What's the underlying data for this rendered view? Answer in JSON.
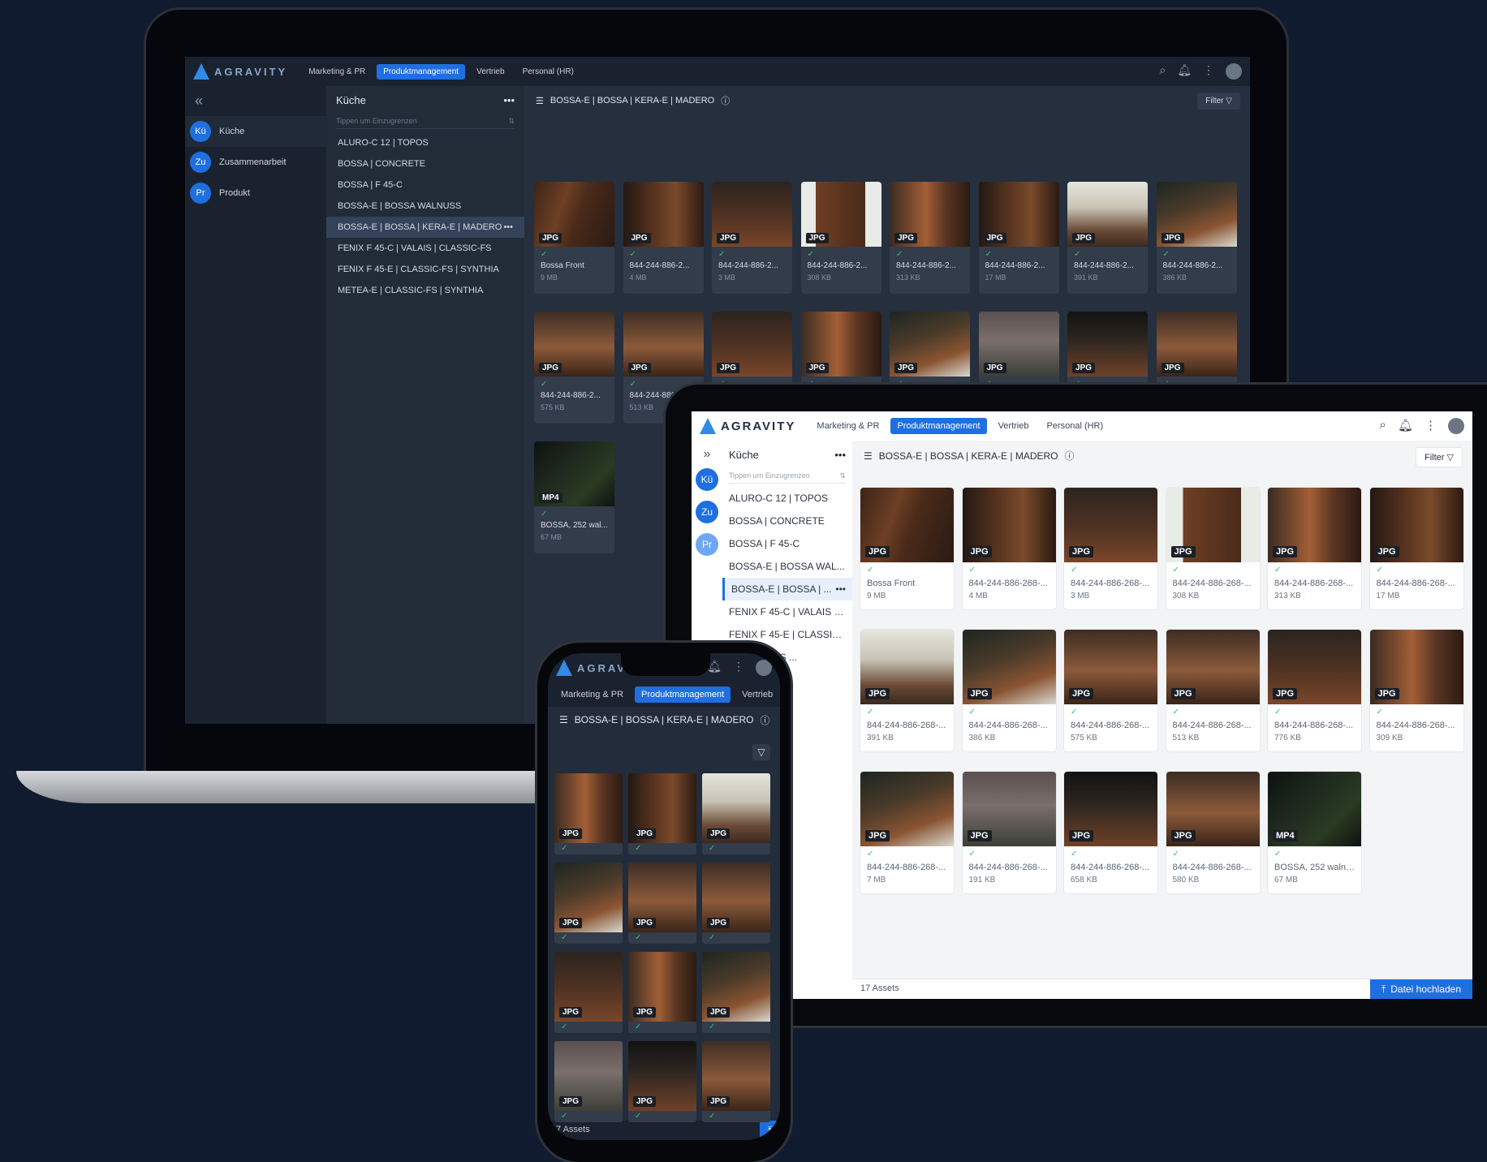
{
  "brand": {
    "logo_text": "AGRAVITY",
    "accent": "#1f6fe0",
    "success": "#36c26e"
  },
  "tabs": [
    "Marketing & PR",
    "Produktmanagement",
    "Vertrieb",
    "Personal (HR)"
  ],
  "active_tab": "Produktmanagement",
  "header_icons": [
    "search-icon",
    "bell-icon",
    "more-vertical-icon",
    "avatar"
  ],
  "sidebar": {
    "collapse_icon": "double-chevron-left-icon",
    "items": [
      {
        "abbr": "Kü",
        "label": "Küche"
      },
      {
        "abbr": "Zu",
        "label": "Zusammenarbeit"
      },
      {
        "abbr": "Pr",
        "label": "Produkt"
      }
    ]
  },
  "folders": {
    "title": "Küche",
    "more": "•••",
    "search_placeholder": "Tippen um Einzugrenzen",
    "items": [
      "ALURO-C 12 | TOPOS",
      "BOSSA | CONCRETE",
      "BOSSA | F 45-C",
      "BOSSA-E | BOSSA WALNUSS",
      "BOSSA-E | BOSSA | KERA-E | MADERO",
      "FENIX F 45-C | VALAIS | CLASSIC-FS",
      "FENIX F 45-E | CLASSIC-FS | SYNTHIA",
      "METEA-E | CLASSIC-FS | SYNTHIA"
    ],
    "selected_index": 4
  },
  "tablet_folders": {
    "items": [
      "ALURO-C 12 | TOPOS",
      "BOSSA | CONCRETE",
      "BOSSA | F 45-C",
      "BOSSA-E | BOSSA WAL...",
      "BOSSA-E | BOSSA | ...",
      "FENIX F 45-C | VALAIS | ...",
      "FENIX F 45-E | CLASSIC...",
      "CLASSIC-FS ..."
    ]
  },
  "content": {
    "breadcrumb": "BOSSA-E | BOSSA | KERA-E | MADERO",
    "filter_label": "Filter",
    "asset_count": "17 Assets",
    "phone_asset_count": "7 Assets",
    "upload_label": "Datei hochladen"
  },
  "laptop_assets": [
    {
      "type": "JPG",
      "name": "Bossa Front",
      "size": "9 MB"
    },
    {
      "type": "JPG",
      "name": "844-244-886-2...",
      "size": "4 MB"
    },
    {
      "type": "JPG",
      "name": "844-244-886-2...",
      "size": "3 MB"
    },
    {
      "type": "JPG",
      "name": "844-244-886-2...",
      "size": "308 KB"
    },
    {
      "type": "JPG",
      "name": "844-244-886-2...",
      "size": "313 KB"
    },
    {
      "type": "JPG",
      "name": "844-244-886-2...",
      "size": "17 MB"
    },
    {
      "type": "JPG",
      "name": "844-244-886-2...",
      "size": "391 KB"
    },
    {
      "type": "JPG",
      "name": "844-244-886-2...",
      "size": "386 KB"
    },
    {
      "type": "JPG",
      "name": "844-244-886-2...",
      "size": "575 KB"
    },
    {
      "type": "JPG",
      "name": "844-244-886-2...",
      "size": "513 KB"
    },
    {
      "type": "JPG",
      "name": "844-244-886-2...",
      "size": "776 KB"
    },
    {
      "type": "JPG",
      "name": "844-244-886-2...",
      "size": "309 KB"
    },
    {
      "type": "JPG",
      "name": "844-244-886-2...",
      "size": "7 MB"
    },
    {
      "type": "JPG",
      "name": "844-244-886-2...",
      "size": "191 KB"
    },
    {
      "type": "JPG",
      "name": "844-244-886-2...",
      "size": "658 KB"
    },
    {
      "type": "JPG",
      "name": "844-244-886-2...",
      "size": "580 KB"
    },
    {
      "type": "MP4",
      "name": "BOSSA, 252 wal...",
      "size": "67 MB"
    }
  ],
  "tablet_assets": [
    {
      "type": "JPG",
      "name": "Bossa Front",
      "size": "9 MB"
    },
    {
      "type": "JPG",
      "name": "844-244-886-268-...",
      "size": "4 MB"
    },
    {
      "type": "JPG",
      "name": "844-244-886-268-...",
      "size": "3 MB"
    },
    {
      "type": "JPG",
      "name": "844-244-886-268-...",
      "size": "308 KB"
    },
    {
      "type": "JPG",
      "name": "844-244-886-268-...",
      "size": "313 KB"
    },
    {
      "type": "JPG",
      "name": "844-244-886-268-...",
      "size": "17 MB"
    },
    {
      "type": "JPG",
      "name": "844-244-886-268-...",
      "size": "391 KB"
    },
    {
      "type": "JPG",
      "name": "844-244-886-268-...",
      "size": "386 KB"
    },
    {
      "type": "JPG",
      "name": "844-244-886-268-...",
      "size": "575 KB"
    },
    {
      "type": "JPG",
      "name": "844-244-886-268-...",
      "size": "513 KB"
    },
    {
      "type": "JPG",
      "name": "844-244-886-268-...",
      "size": "776 KB"
    },
    {
      "type": "JPG",
      "name": "844-244-886-268-...",
      "size": "309 KB"
    },
    {
      "type": "JPG",
      "name": "844-244-886-268-...",
      "size": "7 MB"
    },
    {
      "type": "JPG",
      "name": "844-244-886-268-...",
      "size": "191 KB"
    },
    {
      "type": "JPG",
      "name": "844-244-886-268-...",
      "size": "658 KB"
    },
    {
      "type": "JPG",
      "name": "844-244-886-268-...",
      "size": "580 KB"
    },
    {
      "type": "MP4",
      "name": "BOSSA, 252 walnut...",
      "size": "67 MB"
    }
  ],
  "phone_tabs": [
    "Marketing & PR",
    "Produktmanagement",
    "Vertrieb"
  ],
  "phone_badges": [
    "JPG",
    "JPG",
    "JPG",
    "JPG",
    "JPG",
    "JPG",
    "JPG",
    "JPG",
    "JPG",
    "JPG",
    "JPG",
    "JPG"
  ]
}
